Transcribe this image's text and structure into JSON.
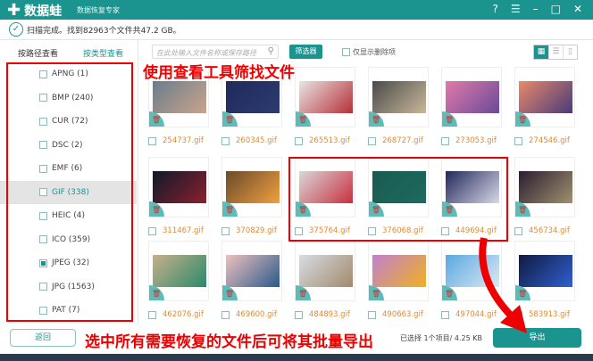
{
  "app": {
    "name": "数据蛙",
    "subtitle": "数据恢复专家",
    "controls": {
      "help": "?",
      "menu": "☰",
      "minimize": "–",
      "maximize": "□",
      "close": "✕"
    }
  },
  "status": {
    "text": "扫描完成。找到82963个文件共47.2 GB。"
  },
  "tabs": {
    "by_path": "按路径查看",
    "by_type": "按类型查看"
  },
  "sidebar": {
    "items": [
      {
        "label": "APNG (1)",
        "checked": false
      },
      {
        "label": "BMP (240)",
        "checked": false
      },
      {
        "label": "CUR (72)",
        "checked": false
      },
      {
        "label": "DSC (2)",
        "checked": false
      },
      {
        "label": "EMF (6)",
        "checked": false
      },
      {
        "label": "GIF (338)",
        "checked": false,
        "active": true
      },
      {
        "label": "HEIC (4)",
        "checked": false
      },
      {
        "label": "ICO (359)",
        "checked": false
      },
      {
        "label": "JPEG (32)",
        "checked": true
      },
      {
        "label": "JPG (1563)",
        "checked": false
      },
      {
        "label": "PAT (7)",
        "checked": false
      }
    ]
  },
  "toolbar": {
    "search_placeholder": "在此处输入文件名称或保存路径",
    "filter_label": "筛选器",
    "only_deleted_label": "仅显示删除项",
    "only_deleted_checked": false
  },
  "files": [
    {
      "name": "254737.gif",
      "colors": [
        "#6a7d8c",
        "#c9a48c"
      ]
    },
    {
      "name": "260345.gif",
      "colors": [
        "#1f2a5a",
        "#2e3b70"
      ]
    },
    {
      "name": "265513.gif",
      "colors": [
        "#e9e4e2",
        "#b5303a"
      ]
    },
    {
      "name": "268727.gif",
      "colors": [
        "#4a4a4a",
        "#c8b89a"
      ]
    },
    {
      "name": "273053.gif",
      "colors": [
        "#e07aa8",
        "#6b4a9a"
      ]
    },
    {
      "name": "274546.gif",
      "colors": [
        "#e88a6a",
        "#4a3a7a"
      ]
    },
    {
      "name": "311467.gif",
      "colors": [
        "#0e1a28",
        "#8a2030"
      ]
    },
    {
      "name": "370829.gif",
      "colors": [
        "#6a4a2a",
        "#f0a040"
      ]
    },
    {
      "name": "375764.gif",
      "colors": [
        "#d8d8d8",
        "#c83040"
      ]
    },
    {
      "name": "376068.gif",
      "colors": [
        "#1a5a50",
        "#1e6a60"
      ]
    },
    {
      "name": "449694.gif",
      "colors": [
        "#22285a",
        "#d8d8e8"
      ]
    },
    {
      "name": "456734.gif",
      "colors": [
        "#2a1e30",
        "#a09070"
      ]
    },
    {
      "name": "462076.gif",
      "colors": [
        "#c8b08a",
        "#2a8a6a"
      ]
    },
    {
      "name": "469600.gif",
      "colors": [
        "#f0c0c0",
        "#2a5a8a"
      ]
    },
    {
      "name": "484893.gif",
      "colors": [
        "#d8dce4",
        "#a08a6a"
      ]
    },
    {
      "name": "490663.gif",
      "colors": [
        "#c080d0",
        "#f0b020"
      ]
    },
    {
      "name": "497044.gif",
      "colors": [
        "#5aa8e0",
        "#dce8f4"
      ]
    },
    {
      "name": "583913.gif",
      "colors": [
        "#101a40",
        "#3060d0"
      ]
    }
  ],
  "footer": {
    "back_label": "返回",
    "selection_info": "已选择 1个项目/ 4.25 KB",
    "export_label": "导出"
  },
  "annotations": {
    "top": "使用查看工具筛找文件",
    "bottom": "选中所有需要恢复的文件后可将其批量导出"
  },
  "colors": {
    "accent": "#1b9490",
    "file_name": "#e38a2e",
    "annotation": "#ee0000"
  }
}
